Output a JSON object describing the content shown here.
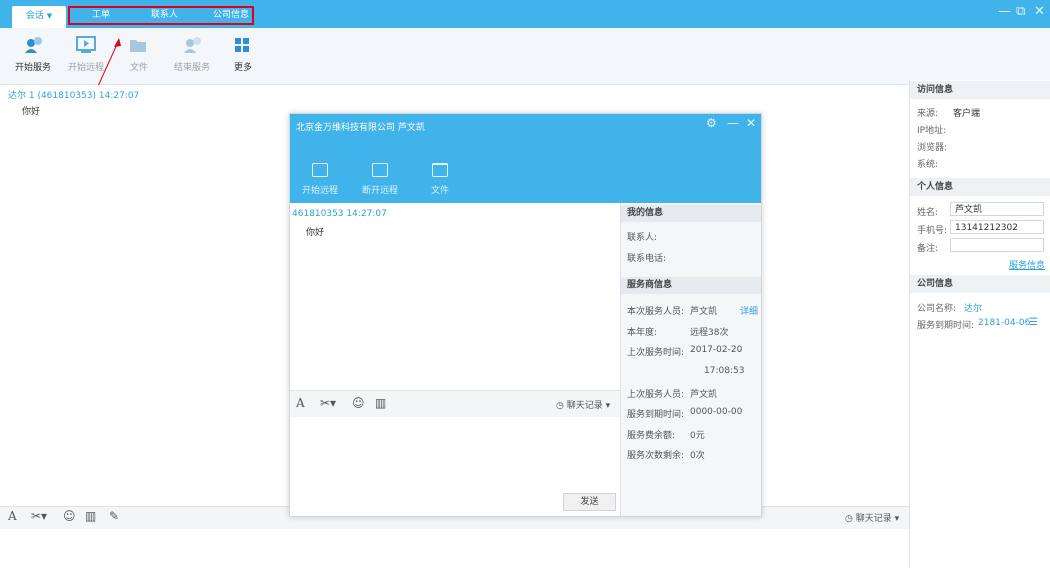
{
  "topbar": {
    "session_tab": "会话",
    "tabs": [
      "工单",
      "联系人",
      "公司信息"
    ],
    "window_controls": [
      "—",
      "⧉",
      "✕"
    ]
  },
  "toolbar": {
    "items": [
      {
        "label": "开始服务",
        "icon": "user-service-icon",
        "enabled": true
      },
      {
        "label": "开始远程",
        "icon": "remote-screen-icon",
        "enabled": false
      },
      {
        "label": "文件",
        "icon": "folder-icon",
        "enabled": false
      },
      {
        "label": "结束服务",
        "icon": "end-service-icon",
        "enabled": false
      },
      {
        "label": "更多",
        "icon": "grid-more-icon",
        "enabled": true
      }
    ]
  },
  "chat": {
    "sender_line": "达尔 1 (461810353) 14:27:07",
    "message": "你好"
  },
  "bottom": {
    "history_label": "聊天记录"
  },
  "right_panel": {
    "visit_title": "访问信息",
    "visit_fields": [
      {
        "label": "来源:",
        "value": "客户端"
      },
      {
        "label": "IP地址:",
        "value": ""
      },
      {
        "label": "浏览器:",
        "value": ""
      },
      {
        "label": "系统:",
        "value": ""
      }
    ],
    "personal_title": "个人信息",
    "name_label": "姓名:",
    "name_value": "芦文凯",
    "phone_label": "手机号:",
    "phone_value": "13141212302",
    "note_label": "备注:",
    "note_value": "",
    "service_link": "服务信息",
    "company_title": "公司信息",
    "company_label": "公司名称:",
    "company_value": "达尔",
    "expire_label": "服务到期时间:",
    "expire_value": "2181-04-06"
  },
  "dialog": {
    "title": "北京金万维科技有限公司 芦文凯",
    "controls": [
      "⚙",
      "—",
      "✕"
    ],
    "tools": [
      "开始远程",
      "断开远程",
      "文件"
    ],
    "sender_line": "461810353 14:27:07",
    "message": "你好",
    "history_label": "聊天记录",
    "send_label": "发送",
    "my_info_title": "我的信息",
    "contact_label": "联系人:",
    "phone_label": "联系电话:",
    "provider_title": "服务商信息",
    "this_staff_label": "本次服务人员:",
    "this_staff_value": "芦文凯",
    "detail_link": "详细",
    "year_label": "本年度:",
    "year_value": "远程38次",
    "last_time_label": "上次服务时间:",
    "last_date": "2017-02-20",
    "last_time": "17:08:53",
    "last_staff_label": "上次服务人员:",
    "last_staff_value": "芦文凯",
    "expire_label": "服务到期时间:",
    "expire_value": "0000-00-00",
    "balance_label": "服务费余额:",
    "balance_value": "0元",
    "remaining_label": "服务次数剩余:",
    "remaining_value": "0次"
  }
}
